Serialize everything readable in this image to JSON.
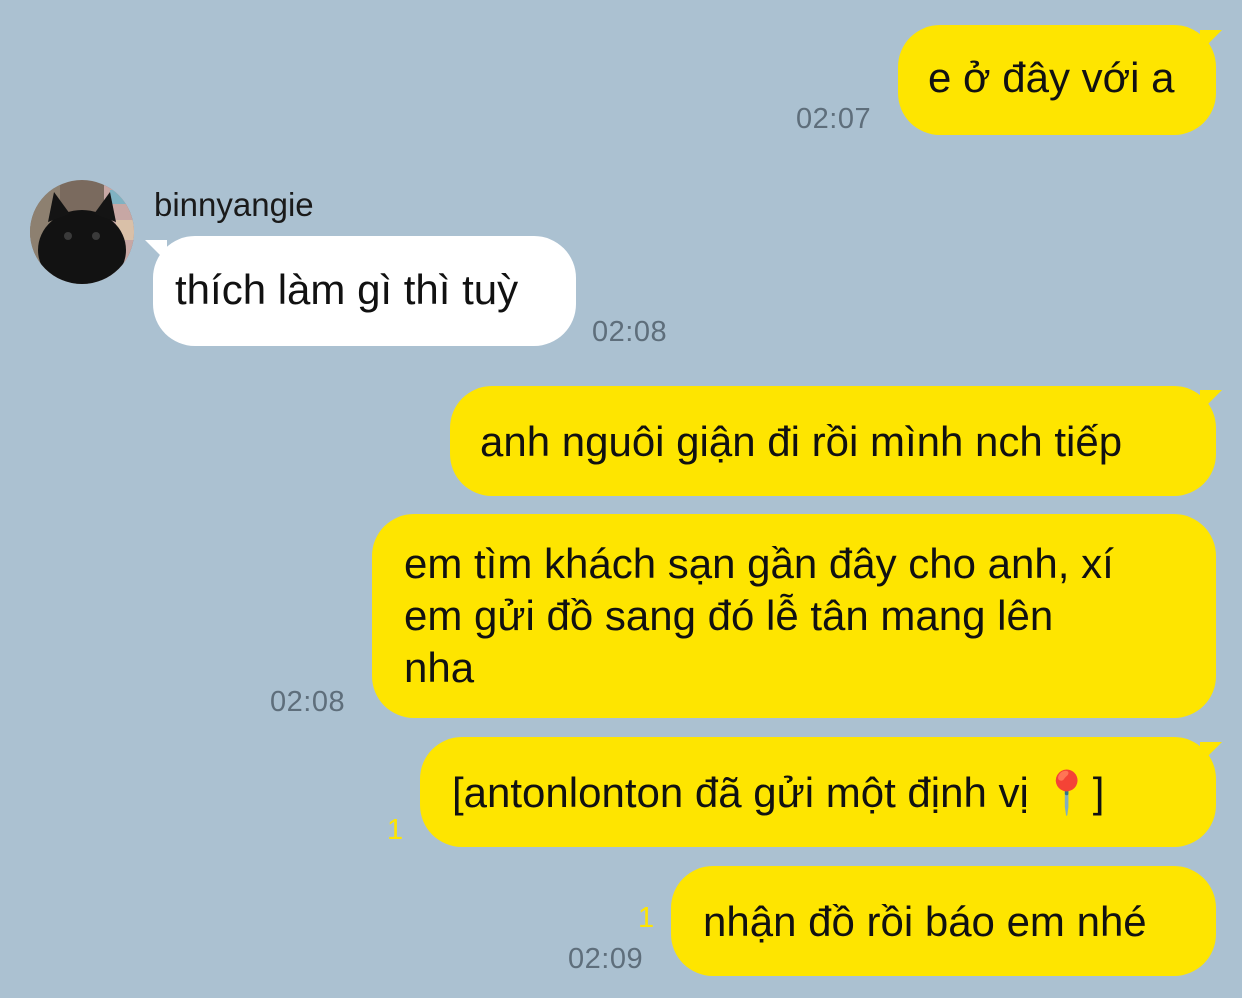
{
  "chat": {
    "messages": [
      {
        "text": "e ở đây với a",
        "time": "02:07"
      },
      {
        "sender": "binnyangie",
        "text": "thích làm gì thì tuỳ",
        "time": "02:08"
      },
      {
        "text": "anh nguôi giận đi rồi mình nch tiếp"
      },
      {
        "text": "em tìm khách sạn gần đây cho anh, xí\nem gửi đồ sang đó lễ tân mang lên\nnha",
        "time": "02:08"
      },
      {
        "text": "[antonlonton đã gửi một định vị ",
        "pin": "📍",
        "close": "]",
        "unread": "1"
      },
      {
        "text": "nhận đồ rồi báo em nhé",
        "unread": "1",
        "time": "02:09"
      }
    ]
  },
  "colors": {
    "background": "#abc1d1",
    "sent_bubble": "#fee500",
    "received_bubble": "#ffffff",
    "timestamp": "#5e6e7b"
  },
  "icons": {
    "avatar": "black-cat-avatar",
    "location": "map-pin-icon"
  }
}
